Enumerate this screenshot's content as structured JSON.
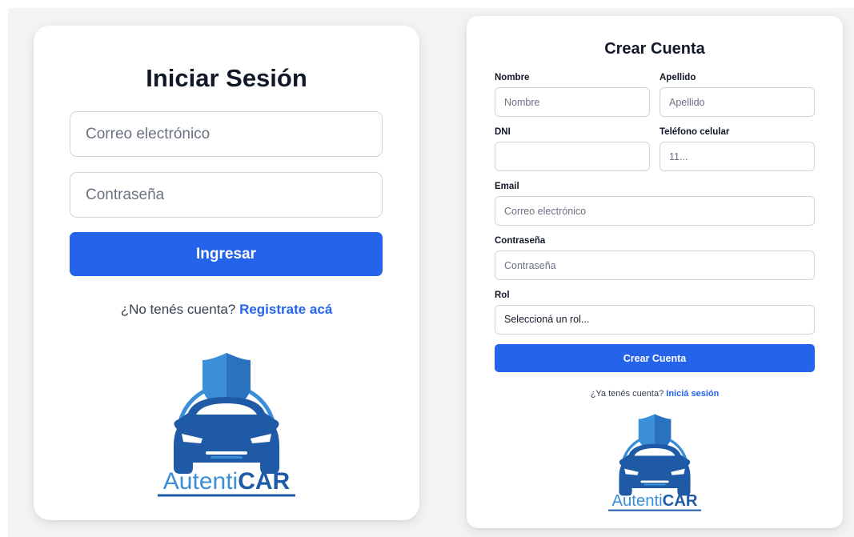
{
  "login": {
    "title": "Iniciar Sesión",
    "email_placeholder": "Correo electrónico",
    "password_placeholder": "Contraseña",
    "submit_label": "Ingresar",
    "switch_prompt": "¿No tenés cuenta? ",
    "switch_link": "Registrate acá"
  },
  "register": {
    "title": "Crear Cuenta",
    "fields": {
      "nombre_label": "Nombre",
      "nombre_placeholder": "Nombre",
      "apellido_label": "Apellido",
      "apellido_placeholder": "Apellido",
      "dni_label": "DNI",
      "dni_placeholder": "",
      "telefono_label": "Teléfono celular",
      "telefono_placeholder": "11...",
      "email_label": "Email",
      "email_placeholder": "Correo electrónico",
      "password_label": "Contraseña",
      "password_placeholder": "Contraseña",
      "rol_label": "Rol",
      "rol_selected": "Seleccioná un rol..."
    },
    "submit_label": "Crear Cuenta",
    "switch_prompt": "¿Ya tenés cuenta? ",
    "switch_link": "Iniciá sesión"
  },
  "logo": {
    "text_light": "Autenti",
    "text_bold": "CAR",
    "icon": "car-shield-icon"
  },
  "colors": {
    "primary": "#2563eb",
    "logo_dark": "#1f5aa6",
    "logo_light": "#3b8ed8"
  }
}
